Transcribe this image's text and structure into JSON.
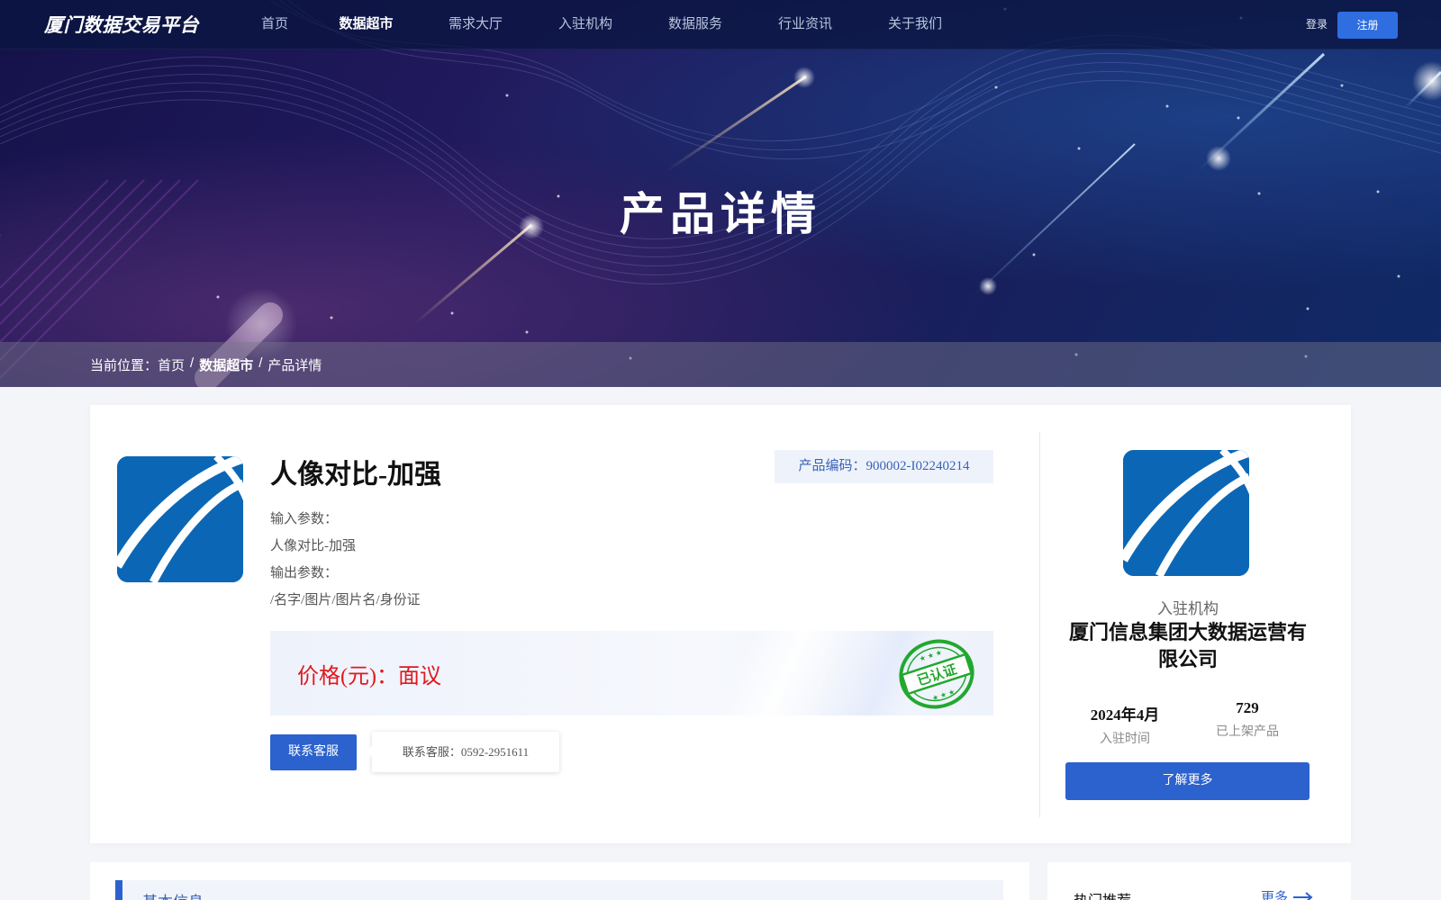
{
  "nav": {
    "logo": "厦门数据交易平台",
    "items": [
      {
        "label": "首页",
        "active": false
      },
      {
        "label": "数据超市",
        "active": true
      },
      {
        "label": "需求大厅",
        "active": false
      },
      {
        "label": "入驻机构",
        "active": false
      },
      {
        "label": "数据服务",
        "active": false
      },
      {
        "label": "行业资讯",
        "active": false
      },
      {
        "label": "关于我们",
        "active": false
      }
    ],
    "login": "登录",
    "register": "注册"
  },
  "hero": {
    "title": "产品详情"
  },
  "breadcrumb": {
    "prefix": "当前位置：首页",
    "sep1": "/",
    "current": "数据超市",
    "sep2": "/",
    "last": "产品详情"
  },
  "product": {
    "name": "人像对比-加强",
    "code": "产品编码：900002-I02240214",
    "input_label": "输入参数：",
    "input_value": "人像对比-加强",
    "output_label": "输出参数：",
    "output_value": "/名字/图片/图片名/身份证",
    "price": "价格(元)：面议",
    "stamp_text": "已认证",
    "contact_button": "联系客服",
    "contact_tip": "联系客服：0592-2951611"
  },
  "org": {
    "label": "入驻机构",
    "name": "厦门信息集团大数据运营有限公司",
    "stats": [
      {
        "value": "2024年4月",
        "key": "入驻时间"
      },
      {
        "value": "729",
        "key": "已上架产品"
      }
    ],
    "more_button": "了解更多"
  },
  "bottom": {
    "basic_info": "基本信息",
    "hot": "热门推荐",
    "more": "更多"
  },
  "colors": {
    "primary": "#2c62cd",
    "price": "#e0191e",
    "stamp": "#22a82f",
    "logo_blue": "#0b67b6"
  }
}
